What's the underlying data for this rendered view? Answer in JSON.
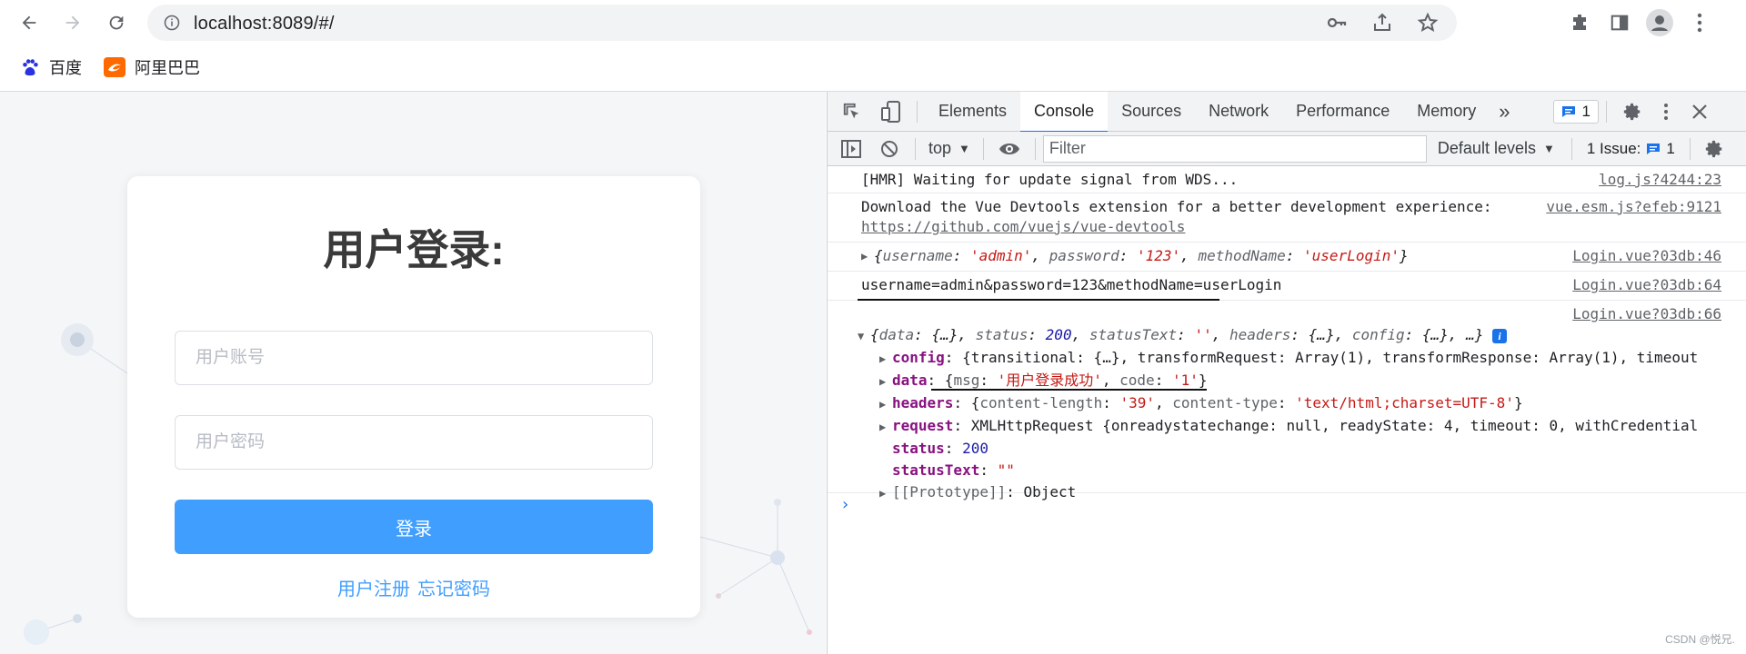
{
  "browser": {
    "url": "localhost:8089/#/",
    "bookmarks": [
      {
        "label": "百度",
        "icon": "baidu-icon"
      },
      {
        "label": "阿里巴巴",
        "icon": "alibaba-icon"
      }
    ]
  },
  "login": {
    "title": "用户登录:",
    "username_placeholder": "用户账号",
    "password_placeholder": "用户密码",
    "submit_label": "登录",
    "register_link": "用户注册",
    "forgot_link": "忘记密码"
  },
  "devtools": {
    "tabs": [
      "Elements",
      "Console",
      "Sources",
      "Network",
      "Performance",
      "Memory"
    ],
    "active_tab": "Console",
    "more_tabs": "»",
    "message_badge": "1",
    "context": "top",
    "filter_placeholder": "Filter",
    "levels": "Default levels",
    "issues_label": "1 Issue:",
    "issues_count": "1"
  },
  "console": {
    "messages": [
      {
        "text": "[HMR] Waiting for update signal from WDS...",
        "source": "log.js?4244:23"
      },
      {
        "text": "Download the Vue Devtools extension for a better development experience:",
        "link": "https://github.com/vuejs/vue-devtools",
        "source": "vue.esm.js?efeb:9121"
      },
      {
        "source": "Login.vue?03db:46"
      },
      {
        "text": "username=admin&password=123&methodName=userLogin",
        "source": "Login.vue?03db:64"
      },
      {
        "source": "Login.vue?03db:66"
      }
    ],
    "obj1": {
      "username": "'admin'",
      "password": "'123'",
      "methodName": "'userLogin'"
    },
    "response": {
      "summary_status": "200",
      "config": "{transitional: {…}, transformRequest: Array(1), transformResponse: Array(1), timeout",
      "data_msg": "'用户登录成功'",
      "data_code": "'1'",
      "headers_len": "'39'",
      "headers_type": "'text/html;charset=UTF-8'",
      "request": "XMLHttpRequest {onreadystatechange: null, readyState: 4, timeout: 0, withCredential",
      "status": "200",
      "statusText": "\"\"",
      "prototype": "Object"
    }
  },
  "watermark": "CSDN @悦兄.",
  "colors": {
    "primary": "#409eff",
    "devtools_accent": "#1a73e8"
  }
}
